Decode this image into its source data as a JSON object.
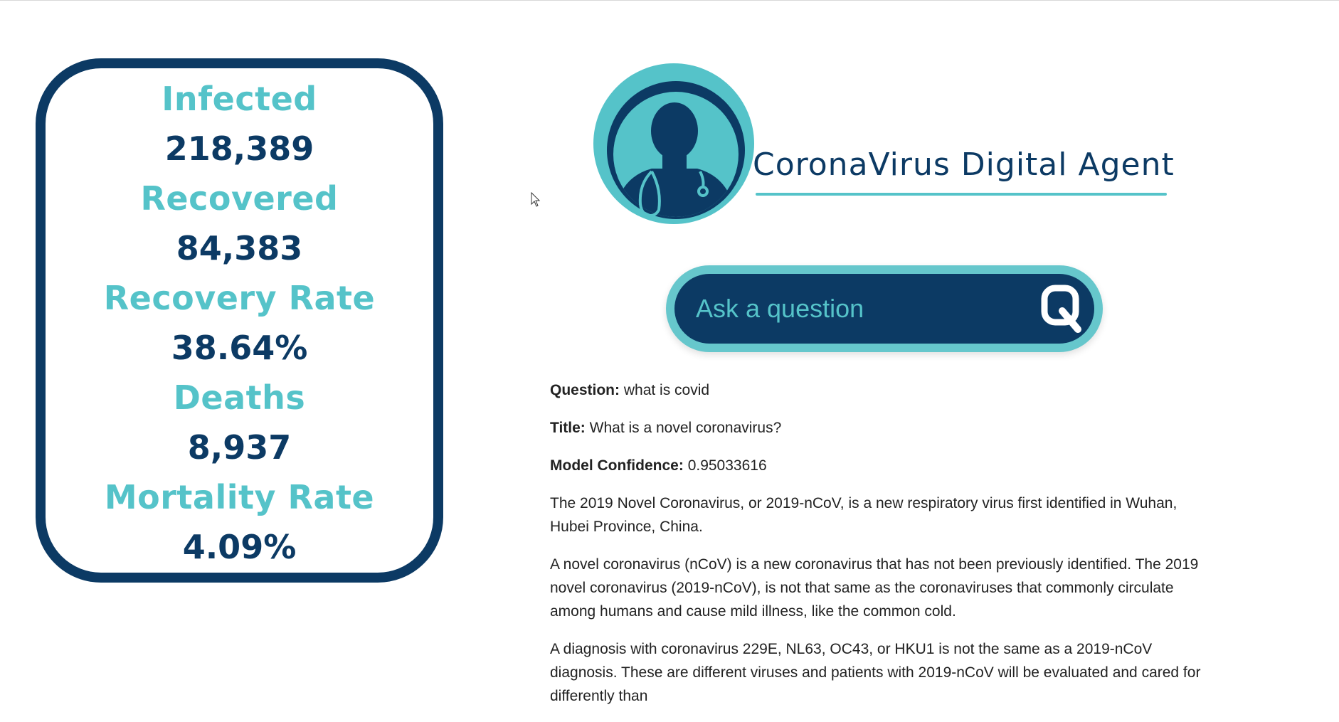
{
  "stats": [
    {
      "label": "Infected",
      "value": "218,389"
    },
    {
      "label": "Recovered",
      "value": "84,383"
    },
    {
      "label": "Recovery Rate",
      "value": "38.64%"
    },
    {
      "label": "Deaths",
      "value": "8,937"
    },
    {
      "label": "Mortality Rate",
      "value": "4.09%"
    }
  ],
  "header": {
    "title": "CoronaVirus Digital Agent",
    "logo_icon": "doctor-avatar-icon"
  },
  "search": {
    "placeholder": "Ask a question",
    "value": "",
    "button_icon": "q-search-icon"
  },
  "answer": {
    "question_label": "Question:",
    "question_value": "what is covid",
    "title_label": "Title:",
    "title_value": "What is a novel coronavirus?",
    "confidence_label": "Model Confidence:",
    "confidence_value": "0.95033616",
    "paragraphs": [
      "The 2019 Novel Coronavirus, or 2019-nCoV, is a new respiratory virus first identified in Wuhan, Hubei Province, China.",
      "A novel coronavirus (nCoV) is a new coronavirus that has not been previously identified. The 2019 novel coronavirus (2019-nCoV), is not that same as the coronaviruses that commonly circulate among humans and cause mild illness, like the common cold.",
      "A diagnosis with coronavirus 229E, NL63, OC43, or HKU1 is not the same as a 2019-nCoV diagnosis. These are different viruses and patients with 2019-nCoV will be evaluated and cared for differently than"
    ]
  },
  "colors": {
    "navy": "#0c3a64",
    "teal": "#55c3c9"
  }
}
